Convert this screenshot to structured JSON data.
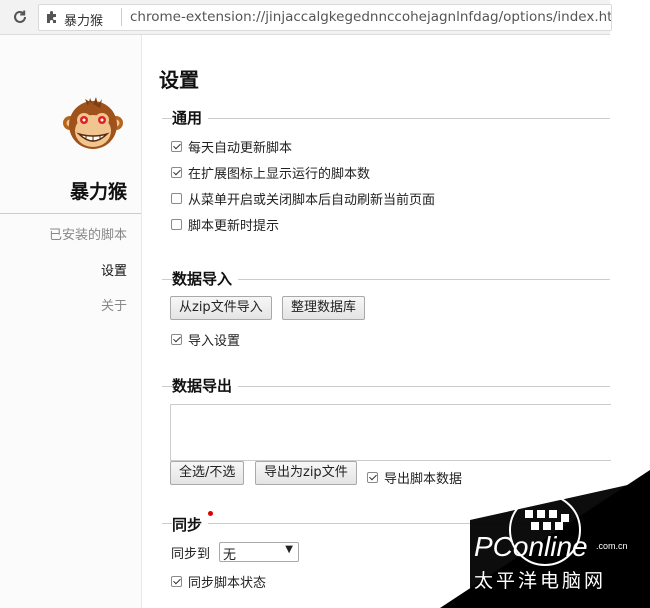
{
  "browser": {
    "tab_name": "暴力猴",
    "url": "chrome-extension://jinjaccalgkegednnccohejagnlnfdag/options/index.html"
  },
  "sidebar": {
    "brand": "暴力猴",
    "items": [
      {
        "label": "已安装的脚本",
        "active": false
      },
      {
        "label": "设置",
        "active": true
      },
      {
        "label": "关于",
        "active": false
      }
    ]
  },
  "main": {
    "title": "设置",
    "general": {
      "heading": "通用",
      "options": [
        {
          "label": "每天自动更新脚本",
          "checked": true
        },
        {
          "label": "在扩展图标上显示运行的脚本数",
          "checked": true
        },
        {
          "label": "从菜单开启或关闭脚本后自动刷新当前页面",
          "checked": false
        },
        {
          "label": "脚本更新时提示",
          "checked": false
        }
      ]
    },
    "import": {
      "heading": "数据导入",
      "import_zip_button": "从zip文件导入",
      "vacuum_button": "整理数据库",
      "import_settings_label": "导入设置",
      "import_settings_checked": true
    },
    "export": {
      "heading": "数据导出",
      "select_all_button": "全选/不选",
      "export_zip_button": "导出为zip文件",
      "export_data_label": "导出脚本数据",
      "export_data_checked": true
    },
    "sync": {
      "heading": "同步",
      "sync_to_label": "同步到",
      "sync_to_value": "无",
      "sync_status_label": "同步脚本状态",
      "sync_status_checked": true
    }
  },
  "watermark": {
    "brand": "PConline",
    "domain": ".com.cn",
    "tagline": "太平洋电脑网"
  },
  "colors": {
    "accent_required": "#d00000",
    "watermark_bg": "#000000"
  }
}
